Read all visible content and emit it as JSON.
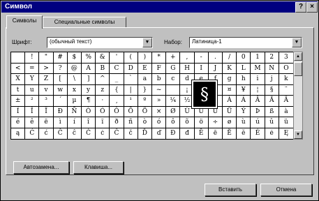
{
  "window": {
    "title": "Символ",
    "help_label": "?",
    "close_label": "×"
  },
  "tabs": [
    {
      "label": "Символы"
    },
    {
      "label": "Специальные символы"
    }
  ],
  "font": {
    "label": "Шрифт:",
    "value": "(обычный текст)"
  },
  "subset": {
    "label": "Набор:",
    "value": "Латиница-1"
  },
  "grid": {
    "rows": [
      [
        " ",
        "!",
        "\"",
        "#",
        "$",
        "%",
        "&",
        "'",
        "(",
        ")",
        "*",
        "+",
        ",",
        "-",
        ".",
        "/",
        "0",
        "1",
        "2",
        "3"
      ],
      [
        "<",
        "=",
        ">",
        "?",
        "@",
        "A",
        "B",
        "C",
        "D",
        "E",
        "F",
        "G",
        "H",
        "I",
        "J",
        "K",
        "L",
        "M",
        "N",
        "O"
      ],
      [
        "X",
        "Y",
        "Z",
        "[",
        "\\",
        "]",
        "^",
        "_",
        "`",
        "a",
        "b",
        "c",
        "d",
        "e",
        "f",
        "g",
        "h",
        "i",
        "j",
        "k"
      ],
      [
        "t",
        "u",
        "v",
        "w",
        "x",
        "y",
        "z",
        "{",
        "|",
        "}",
        "~",
        " ",
        "¡",
        "¢",
        "£",
        "¤",
        "¥",
        "¦",
        "§",
        "¨"
      ],
      [
        "±",
        "²",
        "³",
        "´",
        "µ",
        "¶",
        "·",
        "¸",
        "¹",
        "º",
        "»",
        "¼",
        "½",
        "¾",
        "¿",
        "À",
        "Á",
        "Â",
        "Ã",
        "Ä"
      ],
      [
        "Í",
        "Î",
        "Ï",
        "Ð",
        "Ñ",
        "Ò",
        "Ó",
        "Ô",
        "Õ",
        "Ö",
        "×",
        "Ø",
        "Ù",
        "Ú",
        "Û",
        "Ü",
        "Ý",
        "Þ",
        "ß",
        "à"
      ],
      [
        "é",
        "ê",
        "ë",
        "ì",
        "í",
        "î",
        "ï",
        "ð",
        "ñ",
        "ò",
        "ó",
        "ô",
        "õ",
        "ö",
        "÷",
        "ø",
        "ù",
        "ú",
        "û",
        "ü"
      ],
      [
        "ą",
        "Ć",
        "ć",
        "Ĉ",
        "ĉ",
        "Ċ",
        "ċ",
        "Č",
        "č",
        "Ď",
        "ď",
        "Đ",
        "đ",
        "Ē",
        "ē",
        "Ĕ",
        "ĕ",
        "Ė",
        "ė",
        "Ę"
      ]
    ]
  },
  "selected_char": "§",
  "buttons": {
    "autocorrect": "Автозамена...",
    "shortcut_key": "Клавиша...",
    "insert": "Вставить",
    "cancel": "Отмена"
  }
}
